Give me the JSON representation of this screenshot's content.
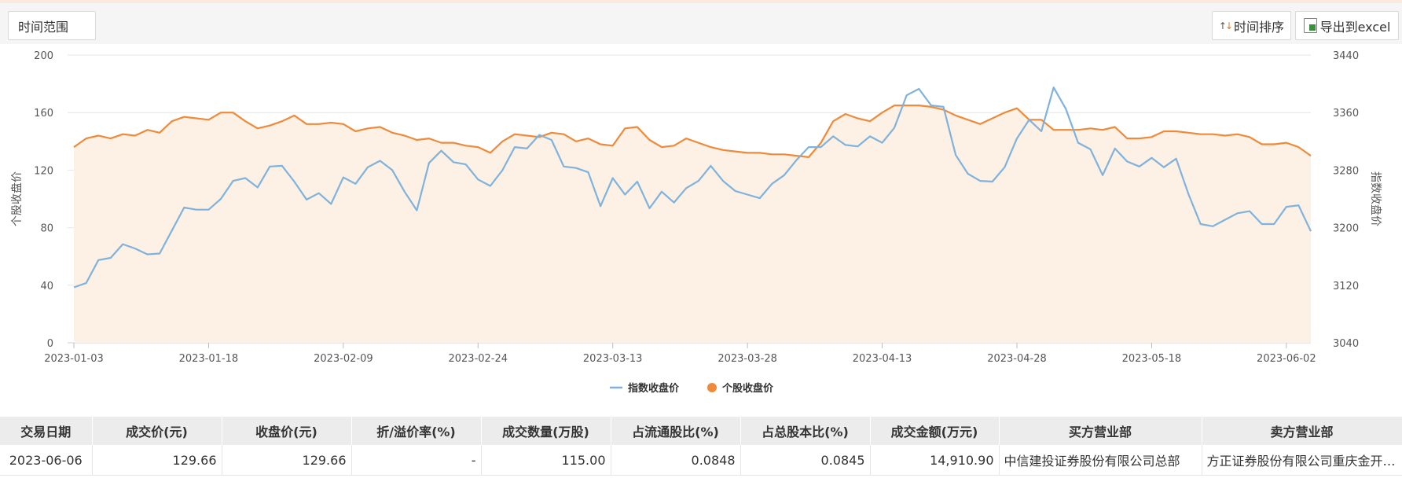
{
  "toolbar": {
    "time_range_label": "时间范围",
    "sort_label": "时间排序",
    "export_label": "导出到excel"
  },
  "chart_data": {
    "type": "line",
    "x": [
      "2023-01-03",
      "2023-01-04",
      "2023-01-05",
      "2023-01-06",
      "2023-01-09",
      "2023-01-10",
      "2023-01-11",
      "2023-01-12",
      "2023-01-13",
      "2023-01-16",
      "2023-01-17",
      "2023-01-18",
      "2023-01-19",
      "2023-01-20",
      "2023-01-30",
      "2023-01-31",
      "2023-02-01",
      "2023-02-02",
      "2023-02-03",
      "2023-02-06",
      "2023-02-07",
      "2023-02-08",
      "2023-02-09",
      "2023-02-10",
      "2023-02-13",
      "2023-02-14",
      "2023-02-15",
      "2023-02-16",
      "2023-02-17",
      "2023-02-20",
      "2023-02-21",
      "2023-02-22",
      "2023-02-23",
      "2023-02-24",
      "2023-02-27",
      "2023-02-28",
      "2023-03-01",
      "2023-03-02",
      "2023-03-03",
      "2023-03-06",
      "2023-03-07",
      "2023-03-08",
      "2023-03-09",
      "2023-03-10",
      "2023-03-13",
      "2023-03-14",
      "2023-03-15",
      "2023-03-16",
      "2023-03-17",
      "2023-03-20",
      "2023-03-21",
      "2023-03-22",
      "2023-03-23",
      "2023-03-24",
      "2023-03-27",
      "2023-03-28",
      "2023-03-29",
      "2023-03-30",
      "2023-03-31",
      "2023-04-03",
      "2023-04-04",
      "2023-04-06",
      "2023-04-07",
      "2023-04-10",
      "2023-04-11",
      "2023-04-12",
      "2023-04-13",
      "2023-04-14",
      "2023-04-17",
      "2023-04-18",
      "2023-04-19",
      "2023-04-20",
      "2023-04-21",
      "2023-04-24",
      "2023-04-25",
      "2023-04-26",
      "2023-04-27",
      "2023-04-28",
      "2023-05-04",
      "2023-05-05",
      "2023-05-08",
      "2023-05-09",
      "2023-05-10",
      "2023-05-11",
      "2023-05-12",
      "2023-05-15",
      "2023-05-16",
      "2023-05-17",
      "2023-05-18",
      "2023-05-19",
      "2023-05-22",
      "2023-05-23",
      "2023-05-24",
      "2023-05-25",
      "2023-05-26",
      "2023-05-29",
      "2023-05-30",
      "2023-05-31",
      "2023-06-01",
      "2023-06-02",
      "2023-06-05",
      "2023-06-06"
    ],
    "x_ticks": [
      "2023-01-03",
      "2023-01-18",
      "2023-02-09",
      "2023-02-24",
      "2023-03-13",
      "2023-03-28",
      "2023-04-13",
      "2023-04-28",
      "2023-05-18",
      "2023-06-02"
    ],
    "y_left": {
      "label": "个股收盘价",
      "ticks": [
        0,
        40,
        80,
        120,
        160,
        200
      ],
      "range": [
        0,
        200
      ]
    },
    "y_right": {
      "label": "指数收盘价",
      "ticks": [
        3040,
        3120,
        3200,
        3280,
        3360,
        3440
      ],
      "range": [
        3040,
        3440
      ]
    },
    "series": [
      {
        "name": "指数收盘价",
        "axis": "right",
        "color": "#7fb2dc",
        "values": [
          3117,
          3123,
          3155,
          3158,
          3177,
          3171,
          3163,
          3164,
          3196,
          3228,
          3225,
          3225,
          3240,
          3265,
          3269,
          3256,
          3285,
          3286,
          3264,
          3239,
          3248,
          3233,
          3270,
          3261,
          3284,
          3293,
          3280,
          3250,
          3224,
          3290,
          3307,
          3291,
          3288,
          3267,
          3258,
          3280,
          3312,
          3310,
          3329,
          3322,
          3285,
          3283,
          3277,
          3230,
          3269,
          3246,
          3264,
          3227,
          3250,
          3235,
          3255,
          3265,
          3286,
          3265,
          3251,
          3246,
          3241,
          3261,
          3273,
          3294,
          3312,
          3312,
          3327,
          3315,
          3313,
          3327,
          3318,
          3339,
          3384,
          3393,
          3370,
          3368,
          3301,
          3275,
          3265,
          3264,
          3284,
          3324,
          3350,
          3334,
          3395,
          3365,
          3318,
          3309,
          3273,
          3310,
          3292,
          3285,
          3297,
          3284,
          3296,
          3247,
          3205,
          3202,
          3211,
          3220,
          3223,
          3205,
          3205,
          3229,
          3231,
          3195
        ]
      },
      {
        "name": "个股收盘价",
        "axis": "left",
        "color": "#ee8a3a",
        "values": [
          136,
          142,
          144,
          142,
          145,
          144,
          148,
          146,
          154,
          157,
          156,
          155,
          160,
          160,
          154,
          149,
          151,
          154,
          158,
          152,
          152,
          153,
          152,
          147,
          149,
          150,
          146,
          144,
          141,
          142,
          139,
          139,
          137,
          136,
          132,
          140,
          145,
          144,
          143,
          146,
          145,
          140,
          142,
          138,
          137,
          149,
          150,
          141,
          136,
          137,
          142,
          139,
          136,
          134,
          133,
          132,
          132,
          131,
          131,
          130,
          129,
          139,
          154,
          159,
          156,
          154,
          160,
          165,
          165,
          165,
          164,
          162,
          158,
          155,
          152,
          156,
          160,
          163,
          155,
          155,
          148,
          148,
          148,
          149,
          148,
          150,
          142,
          142,
          143,
          147,
          147,
          146,
          145,
          145,
          144,
          145,
          143,
          138,
          138,
          139,
          136,
          130
        ]
      }
    ],
    "legend_position": "bottom-center",
    "grid": true
  },
  "table": {
    "headers": [
      "交易日期",
      "成交价(元)",
      "收盘价(元)",
      "折/溢价率(%)",
      "成交数量(万股)",
      "占流通股比(%)",
      "占总股本比(%)",
      "成交金额(万元)",
      "买方营业部",
      "卖方营业部"
    ],
    "rows": [
      [
        "2023-06-06",
        "129.66",
        "129.66",
        "-",
        "115.00",
        "0.0848",
        "0.0845",
        "14,910.90",
        "中信建投证券股份有限公司总部",
        "方正证券股份有限公司重庆金开大道证券营业部"
      ]
    ]
  }
}
